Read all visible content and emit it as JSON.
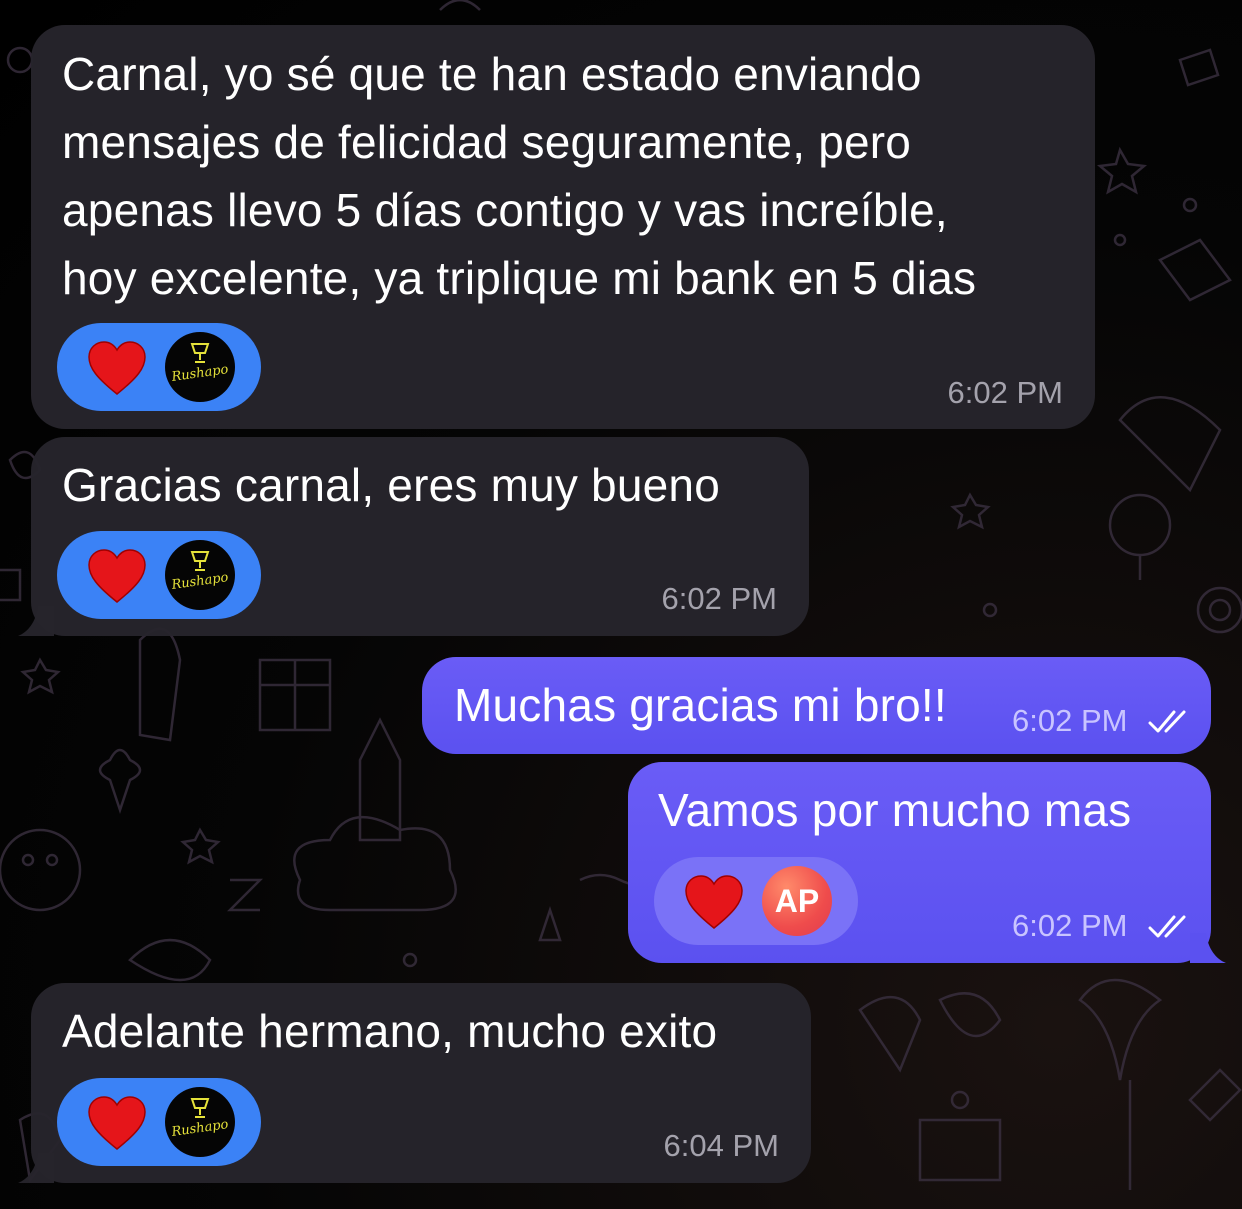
{
  "theme": {
    "incoming_bubble": "#26242c",
    "outgoing_bubble": "#6a5cf6",
    "reaction_pill": "#3b82f6",
    "heart_color": "#e5151a",
    "avatar_logo_color": "#e5e23a"
  },
  "messages": [
    {
      "direction": "incoming",
      "text": "Carnal, yo sé que te han estado enviando\nmensajes de felicidad seguramente, pero\napenas llevo 5 días contigo y vas increíble,\nhoy excelente, ya triplique mi bank en 5 dias",
      "time": "6:02 PM",
      "reaction": {
        "emoji": "heart-icon",
        "avatar_text": "Rushapo"
      }
    },
    {
      "direction": "incoming",
      "text": "Gracias carnal, eres muy bueno",
      "time": "6:02 PM",
      "reaction": {
        "emoji": "heart-icon",
        "avatar_text": "Rushapo"
      }
    },
    {
      "direction": "outgoing",
      "text": "Muchas gracias mi bro!!",
      "time": "6:02 PM",
      "status": "read"
    },
    {
      "direction": "outgoing",
      "text": "Vamos por mucho mas",
      "time": "6:02 PM",
      "status": "read",
      "reaction": {
        "emoji": "heart-icon",
        "avatar_text": "AP"
      }
    },
    {
      "direction": "incoming",
      "text": "Adelante hermano, mucho exito",
      "time": "6:04 PM",
      "reaction": {
        "emoji": "heart-icon",
        "avatar_text": "Rushapo"
      }
    }
  ]
}
